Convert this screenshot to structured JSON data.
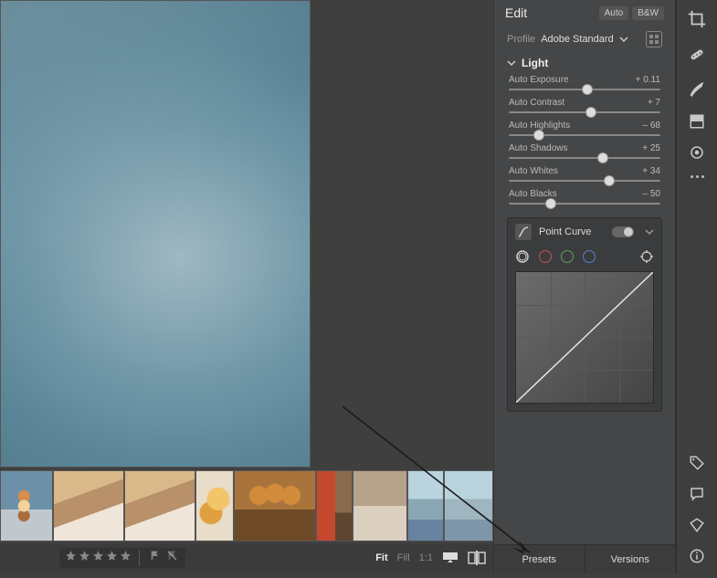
{
  "header": {
    "title": "Edit",
    "btn_auto": "Auto",
    "btn_bw": "B&W"
  },
  "profile": {
    "label": "Profile",
    "value": "Adobe Standard"
  },
  "light_section": {
    "title": "Light"
  },
  "sliders": [
    {
      "name": "Auto Exposure",
      "value": "+ 0.11",
      "pos": 52
    },
    {
      "name": "Auto Contrast",
      "value": "+ 7",
      "pos": 54
    },
    {
      "name": "Auto Highlights",
      "value": "– 68",
      "pos": 20
    },
    {
      "name": "Auto Shadows",
      "value": "+ 25",
      "pos": 62
    },
    {
      "name": "Auto Whites",
      "value": "+ 34",
      "pos": 66
    },
    {
      "name": "Auto Blacks",
      "value": "– 50",
      "pos": 28
    }
  ],
  "point_curve": {
    "title": "Point Curve",
    "channels": {
      "all": "#ccc",
      "r": "#c0554f",
      "g": "#5fa05f",
      "b": "#5a7fd0"
    }
  },
  "tabs": {
    "presets": "Presets",
    "versions": "Versions"
  },
  "zoom": {
    "fit": "Fit",
    "fill": "Fill",
    "one": "1:1"
  },
  "tools": [
    "crop",
    "heal",
    "brush",
    "linear",
    "radial",
    "dots"
  ],
  "bottom_tools": [
    "tag",
    "chat",
    "label",
    "info"
  ],
  "filmstrip_count": 10
}
